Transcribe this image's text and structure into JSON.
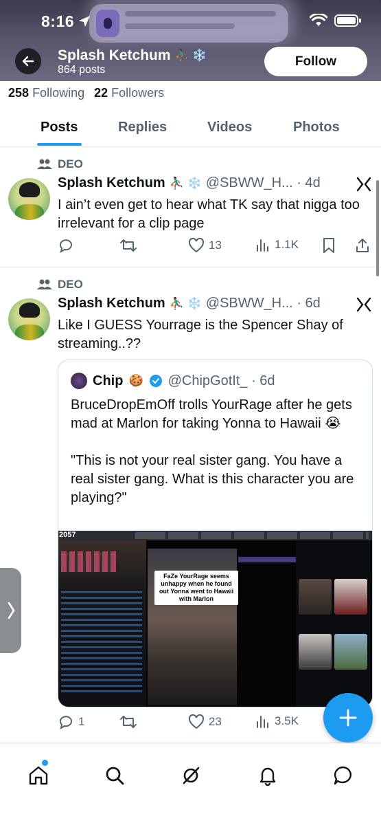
{
  "status_bar": {
    "time": "8:16"
  },
  "header": {
    "display_name": "Splash Ketchum",
    "name_emojis": "⛹🏾‍♂️ ❄️",
    "posts_count": "864 posts",
    "follow_label": "Follow"
  },
  "stats": {
    "following_count": "258",
    "following_label": "Following",
    "followers_count": "22",
    "followers_label": "Followers"
  },
  "tabs": [
    {
      "label": "Posts",
      "active": true
    },
    {
      "label": "Replies",
      "active": false
    },
    {
      "label": "Videos",
      "active": false
    },
    {
      "label": "Photos",
      "active": false
    }
  ],
  "posts": [
    {
      "context": "DEO",
      "name": "Splash Ketchum",
      "emojis": "⛹🏾‍♂️ ❄️",
      "meta": "@SBWW_H... · 4d",
      "text": "I ain’t even get to hear what TK say that nigga too irrelevant for a clip page",
      "likes": "13",
      "views": "1.1K"
    },
    {
      "context": "DEO",
      "name": "Splash Ketchum",
      "emojis": "⛹🏾‍♂️ ❄️",
      "meta": "@SBWW_H... · 6d",
      "text": "Like I GUESS Yourrage is the Spencer Shay of streaming..??",
      "replies": "1",
      "likes": "23",
      "views": "3.5K",
      "quote": {
        "name": "Chip",
        "emoji": "🍪",
        "meta": "@ChipGotIt_ · 6d",
        "text_1": "BruceDropEmOff trolls YourRage after he gets mad at Marlon for taking Yonna to Hawaii 😭",
        "text_2": "\"This is not your real sister gang. You have a real sister gang. What is this character you are playing?\"",
        "media_count": "2057",
        "media_caption": "FaZe YourRage seems unhappy when he found out Yonna went to Hawaii with Marlon"
      }
    }
  ],
  "colors": {
    "accent": "#1d9bf0",
    "secondary_text": "#536471",
    "verified": "#1d9bf0"
  }
}
